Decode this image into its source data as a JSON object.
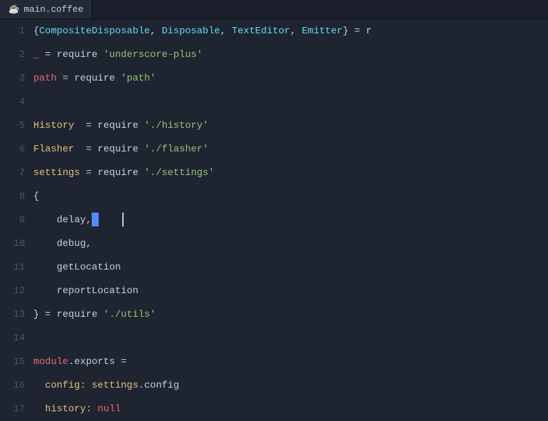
{
  "tab": {
    "icon": "☕",
    "label": "main.coffee"
  },
  "lines": [
    {
      "num": "1",
      "tokens": [
        {
          "text": "{",
          "cls": "c-bracket"
        },
        {
          "text": "CompositeDisposable",
          "cls": "c-class"
        },
        {
          "text": ", ",
          "cls": "c-punct"
        },
        {
          "text": "Disposable",
          "cls": "c-class"
        },
        {
          "text": ", ",
          "cls": "c-punct"
        },
        {
          "text": "TextEditor",
          "cls": "c-class"
        },
        {
          "text": ", ",
          "cls": "c-punct"
        },
        {
          "text": "Emitter",
          "cls": "c-class"
        },
        {
          "text": "} = r",
          "cls": "c-bracket"
        }
      ]
    },
    {
      "num": "2",
      "tokens": [
        {
          "text": "_",
          "cls": "c-var"
        },
        {
          "text": " = ",
          "cls": "c-op"
        },
        {
          "text": "require",
          "cls": "c-keyword"
        },
        {
          "text": " ",
          "cls": "c-white"
        },
        {
          "text": "'underscore-plus'",
          "cls": "c-string"
        }
      ]
    },
    {
      "num": "3",
      "tokens": [
        {
          "text": "path",
          "cls": "c-var"
        },
        {
          "text": " = ",
          "cls": "c-op"
        },
        {
          "text": "require",
          "cls": "c-keyword"
        },
        {
          "text": " ",
          "cls": "c-white"
        },
        {
          "text": "'path'",
          "cls": "c-string"
        }
      ]
    },
    {
      "num": "4",
      "tokens": []
    },
    {
      "num": "5",
      "tokens": [
        {
          "text": "History",
          "cls": "c-var2"
        },
        {
          "text": "  = ",
          "cls": "c-op"
        },
        {
          "text": "require",
          "cls": "c-keyword"
        },
        {
          "text": " ",
          "cls": "c-white"
        },
        {
          "text": "'./history'",
          "cls": "c-string"
        }
      ]
    },
    {
      "num": "6",
      "tokens": [
        {
          "text": "Flasher",
          "cls": "c-var2"
        },
        {
          "text": "  = ",
          "cls": "c-op"
        },
        {
          "text": "require",
          "cls": "c-keyword"
        },
        {
          "text": " ",
          "cls": "c-white"
        },
        {
          "text": "'./flasher'",
          "cls": "c-string"
        }
      ]
    },
    {
      "num": "7",
      "tokens": [
        {
          "text": "settings",
          "cls": "c-var2"
        },
        {
          "text": " = ",
          "cls": "c-op"
        },
        {
          "text": "require",
          "cls": "c-keyword"
        },
        {
          "text": " ",
          "cls": "c-white"
        },
        {
          "text": "'./settings'",
          "cls": "c-string"
        }
      ]
    },
    {
      "num": "8",
      "tokens": [
        {
          "text": "{",
          "cls": "c-bracket"
        }
      ]
    },
    {
      "num": "9",
      "tokens": [
        {
          "text": "    delay,",
          "cls": "c-white"
        },
        {
          "text": " ",
          "cls": "cursor"
        },
        {
          "text": "    ",
          "cls": "c-white"
        }
      ],
      "hasCursor": true,
      "cursorAfter": "delay,"
    },
    {
      "num": "10",
      "tokens": [
        {
          "text": "    debug,",
          "cls": "c-white"
        }
      ]
    },
    {
      "num": "11",
      "tokens": [
        {
          "text": "    getLocation",
          "cls": "c-white"
        }
      ]
    },
    {
      "num": "12",
      "tokens": [
        {
          "text": "    reportLocation",
          "cls": "c-white"
        }
      ]
    },
    {
      "num": "13",
      "tokens": [
        {
          "text": "} = ",
          "cls": "c-bracket"
        },
        {
          "text": "require",
          "cls": "c-keyword"
        },
        {
          "text": " ",
          "cls": "c-white"
        },
        {
          "text": "'./utils'",
          "cls": "c-string"
        }
      ]
    },
    {
      "num": "14",
      "tokens": []
    },
    {
      "num": "15",
      "tokens": [
        {
          "text": "module",
          "cls": "c-var"
        },
        {
          "text": ".exports",
          "cls": "c-white"
        },
        {
          "text": " =",
          "cls": "c-op"
        }
      ]
    },
    {
      "num": "16",
      "tokens": [
        {
          "text": "  config:",
          "cls": "c-prop"
        },
        {
          "text": " settings",
          "cls": "c-var2"
        },
        {
          "text": ".config",
          "cls": "c-white"
        }
      ]
    },
    {
      "num": "17",
      "tokens": [
        {
          "text": "  history:",
          "cls": "c-prop"
        },
        {
          "text": " null",
          "cls": "c-null"
        }
      ]
    }
  ]
}
